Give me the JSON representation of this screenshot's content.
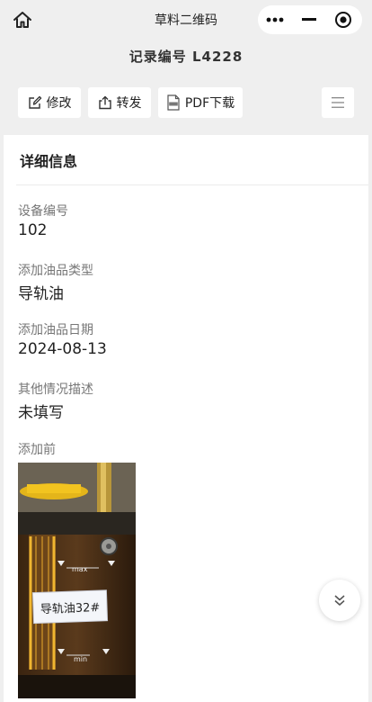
{
  "nav": {
    "app_title": "草料二维码",
    "home_icon": "home-icon",
    "more_icon": "more-dots-icon",
    "minimize_icon": "minimize-icon",
    "close_icon": "target-close-icon"
  },
  "record": {
    "title": "记录编号 L4228"
  },
  "toolbar": {
    "edit_label": "修改",
    "share_label": "转发",
    "pdf_label": "PDF下载",
    "menu_icon": "menu-lines-icon"
  },
  "details": {
    "section_title": "详细信息",
    "fields": [
      {
        "label": "设备编号",
        "value": "102"
      },
      {
        "label": "添加油品类型",
        "value": "导轨油"
      },
      {
        "label": "添加油品日期",
        "value": "2024-08-13"
      },
      {
        "label": "其他情况描述",
        "value": "未填写"
      }
    ],
    "photo_label": "添加前",
    "photo": {
      "sticker_text": "导轨油32#",
      "max_mark": "max",
      "min_mark": "min"
    }
  },
  "scroll_icon": "double-chevron-down-icon"
}
